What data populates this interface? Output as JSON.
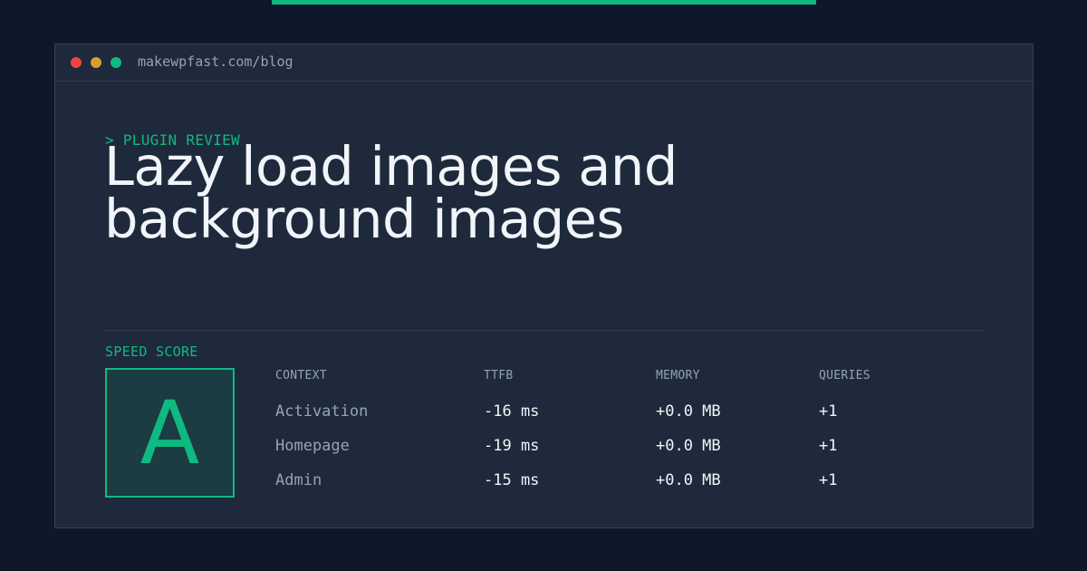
{
  "colors": {
    "background": "#0f172a",
    "window": "#1e293b",
    "accent": "#10b981",
    "dot_red": "#ef4444",
    "dot_yellow": "#d69e2e",
    "dot_green": "#10b981"
  },
  "window": {
    "url": "makewpfast.com/blog",
    "controls": [
      "close-dot",
      "minimize-dot",
      "maximize-dot"
    ]
  },
  "post": {
    "eyebrow": "> PLUGIN REVIEW",
    "title": "Lazy load images and background images"
  },
  "speed_score": {
    "label": "SPEED SCORE",
    "grade": "A"
  },
  "metrics": {
    "headers": [
      "CONTEXT",
      "TTFB",
      "MEMORY",
      "QUERIES"
    ],
    "rows": [
      [
        "Activation",
        "-16 ms",
        "+0.0 MB",
        "+1"
      ],
      [
        "Homepage",
        "-19 ms",
        "+0.0 MB",
        "+1"
      ],
      [
        "Admin",
        "-15 ms",
        "+0.0 MB",
        "+1"
      ]
    ]
  }
}
